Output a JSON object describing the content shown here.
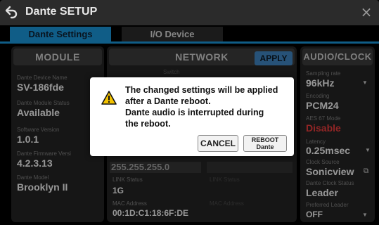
{
  "window": {
    "title": "Dante SETUP",
    "back_icon": "back-arrow-icon",
    "close_icon": "close-icon",
    "close_glyph": "×"
  },
  "tabs": [
    {
      "label": "Dante Settings",
      "active": true
    },
    {
      "label": "I/O Device",
      "active": false
    }
  ],
  "colors": {
    "accent": "#1a8fd0",
    "panel_bg": "#232323",
    "header_bg": "#3a3a3a",
    "warning_red": "#e03a3a",
    "apply_button": "#3d7fb8"
  },
  "module": {
    "header": "MODULE",
    "fields": [
      {
        "label": "Dante Device Name",
        "value": "SV-186fde"
      },
      {
        "label": "Dante Module Status",
        "value": "Available"
      },
      {
        "label": "Software Version",
        "value": "1.0.1"
      },
      {
        "label": "Dante Firmware Versi",
        "value": "4.2.3.13"
      },
      {
        "label": "Dante Model",
        "value": "Brooklyn II"
      }
    ]
  },
  "network": {
    "header": "NETWORK",
    "apply_label": "APPLY",
    "switch_label": "Switch",
    "subnet_value": "255.255.255.0",
    "link_status_label": "LINK Status",
    "link_status_value": "1G",
    "link_status_label_2": "LINK Status",
    "mac_label": "MAC Address",
    "mac_value": "00:1D:C1:18:6F:DE",
    "mac_label_2": "MAC Address"
  },
  "audio_clock": {
    "header": "AUDIO/CLOCK",
    "sampling_rate_label": "Sampling rate",
    "sampling_rate_value": "96kHz",
    "encoding_label": "Encoding",
    "encoding_value": "PCM24",
    "aes67_label": "AES 67 Mode",
    "aes67_value": "Disable",
    "latency_label": "Latency",
    "latency_value": "0.25msec",
    "clock_source_label": "Clock Source",
    "clock_source_value": "Sonicview",
    "dante_clock_status_label": "Dante Clock Status",
    "dante_clock_status_value": "Leader",
    "preferred_leader_label": "Preferred Leader",
    "preferred_leader_value": "OFF",
    "dropdown_glyph": "▼",
    "external_link_glyph": "⧉"
  },
  "dialog": {
    "icon": "warning-icon",
    "message_lines": [
      "The changed settings will be applied",
      "after a Dante reboot.",
      "Dante audio is interrupted during",
      "the reboot."
    ],
    "cancel_label": "CANCEL",
    "reboot_label_line1": "REBOOT",
    "reboot_label_line2": "Dante"
  }
}
